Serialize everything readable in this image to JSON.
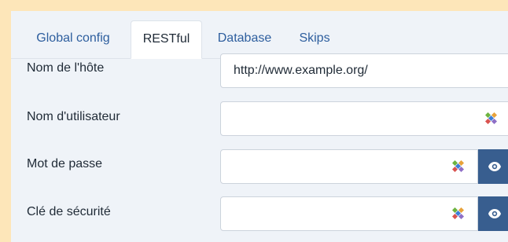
{
  "tabs": [
    {
      "label": "Global config",
      "active": false
    },
    {
      "label": "RESTful",
      "active": true
    },
    {
      "label": "Database",
      "active": false
    },
    {
      "label": "Skips",
      "active": false
    }
  ],
  "form": {
    "hostname": {
      "label": "Nom de l'hôte",
      "value": "http://www.example.org/"
    },
    "username": {
      "label": "Nom d'utilisateur",
      "value": ""
    },
    "password": {
      "label": "Mot de passe",
      "value": ""
    },
    "security_key": {
      "label": "Clé de sécurité",
      "value": ""
    }
  },
  "icons": {
    "password_manager": "password-manager-icon",
    "toggle_visibility": "eye-icon"
  },
  "colors": {
    "accent_button": "#385e8f",
    "tab_link": "#2d5e9e",
    "page_background": "#fde6b9",
    "panel_background": "#eff3f8"
  }
}
